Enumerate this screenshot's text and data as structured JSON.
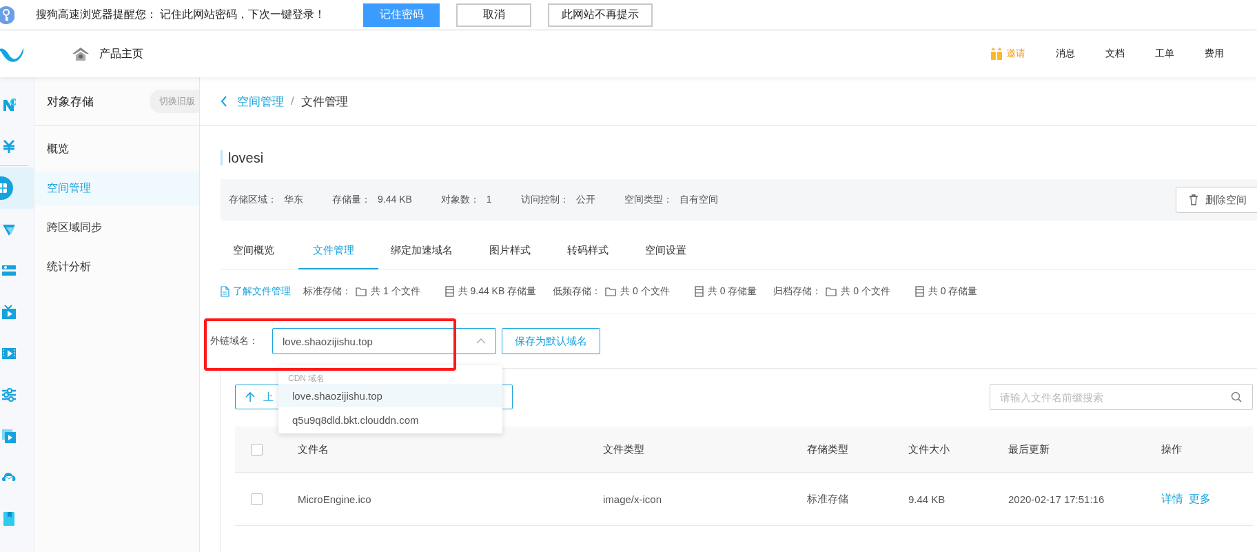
{
  "browser_prompt": {
    "message": "搜狗高速浏览器提醒您： 记住此网站密码，下次一键登录！",
    "buttons": [
      {
        "label": "记住密码",
        "kind": "primary"
      },
      {
        "label": "取消",
        "kind": "default"
      },
      {
        "label": "此网站不再提示",
        "kind": "default"
      }
    ]
  },
  "top_nav": {
    "home_link": "产品主页",
    "items": [
      {
        "label": "邀请",
        "kind": "invite"
      },
      {
        "label": "消息",
        "kind": "plain"
      },
      {
        "label": "文档",
        "kind": "plain"
      },
      {
        "label": "工单",
        "kind": "plain"
      },
      {
        "label": "费用",
        "kind": "plain"
      }
    ]
  },
  "icon_rail": [
    {
      "selected": false
    },
    {
      "selected": false
    },
    {
      "selected": true
    },
    {
      "selected": false
    },
    {
      "selected": false
    },
    {
      "selected": false
    },
    {
      "selected": false
    },
    {
      "selected": false
    },
    {
      "selected": false
    },
    {
      "selected": false
    },
    {
      "selected": false
    }
  ],
  "sidebar": {
    "title": "对象存储",
    "switch_button": "切换旧版",
    "items": [
      {
        "label": "概览",
        "selected": false
      },
      {
        "label": "空间管理",
        "selected": true
      },
      {
        "label": "跨区域同步",
        "selected": false
      },
      {
        "label": "统计分析",
        "selected": false
      }
    ]
  },
  "breadcrumb": [
    "空间管理",
    "/",
    "文件管理"
  ],
  "bucket": {
    "name": "lovesi",
    "info": [
      {
        "label": "存储区域：",
        "value": "华东"
      },
      {
        "label": "存储量：",
        "value": "9.44 KB"
      },
      {
        "label": "对象数：",
        "value": "1"
      },
      {
        "label": "访问控制：",
        "value": "公开"
      },
      {
        "label": "空间类型：",
        "value": "自有空间"
      }
    ],
    "delete_button": "删除空间"
  },
  "tabs": [
    {
      "label": "空间概览",
      "selected": false
    },
    {
      "label": "文件管理",
      "selected": true
    },
    {
      "label": "绑定加速域名",
      "selected": false
    },
    {
      "label": "图片样式",
      "selected": false
    },
    {
      "label": "转码样式",
      "selected": false
    },
    {
      "label": "空间设置",
      "selected": false
    }
  ],
  "stats": {
    "learn_link": "了解文件管理",
    "groups": [
      {
        "label": "标准存储：",
        "files": "共 1 个文件",
        "size": "共 9.44 KB 存储量"
      },
      {
        "label": "低频存储：",
        "files": "共 0 个文件",
        "size": "共 0 存储量"
      },
      {
        "label": "归档存储：",
        "files": "共 0 个文件",
        "size": "共 0 存储量"
      }
    ]
  },
  "domain": {
    "label": "外链域名：",
    "value": "love.shaozijishu.top",
    "save_button": "保存为默认域名",
    "dropdown": {
      "group": "CDN 域名",
      "options": [
        {
          "label": "love.shaozijishu.top",
          "selected": true
        },
        {
          "label": "q5u9q8dld.bkt.clouddn.com",
          "selected": false
        }
      ]
    }
  },
  "toolbar": {
    "upload_button": "上",
    "search": {
      "placeholder": "请输入文件名前缀搜索"
    }
  },
  "table": {
    "header_checked": false,
    "columns": [
      "文件名",
      "文件类型",
      "存储类型",
      "文件大小",
      "最后更新",
      "操作"
    ],
    "rows": [
      {
        "checked": false,
        "cells": [
          "MicroEngine.ico",
          "image/x-icon",
          "标准存储",
          "9.44 KB",
          "2020-02-17 17:51:16"
        ],
        "actions": [
          "详情",
          "更多"
        ]
      }
    ]
  }
}
